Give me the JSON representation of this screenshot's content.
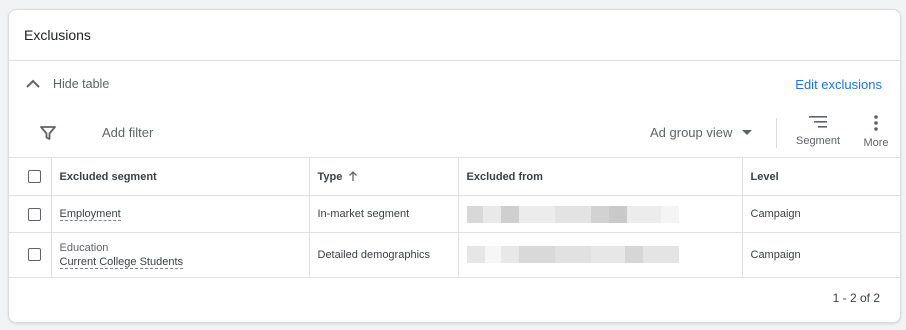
{
  "card": {
    "title": "Exclusions"
  },
  "controls": {
    "hide_table_label": "Hide table",
    "edit_exclusions_label": "Edit exclusions",
    "add_filter_label": "Add filter",
    "view_selector_value": "Ad group view",
    "segment_label": "Segment",
    "more_label": "More"
  },
  "table": {
    "headers": {
      "excluded_segment": "Excluded segment",
      "type": "Type",
      "excluded_from": "Excluded from",
      "level": "Level"
    },
    "sort": {
      "column": "type",
      "direction": "ascending"
    },
    "rows": [
      {
        "segment_category": "",
        "segment": "Employment",
        "type": "In-market segment",
        "excluded_from": "redacted",
        "level": "Campaign"
      },
      {
        "segment_category": "Education",
        "segment": "Current College Students",
        "type": "Detailed demographics",
        "excluded_from": "redacted",
        "level": "Campaign"
      }
    ]
  },
  "pagination": {
    "range_text": "1 - 2 of 2"
  },
  "colors": {
    "accent": "#1a73e8",
    "text": "#3c4043",
    "muted": "#5f6368",
    "border": "#e0e0e0"
  },
  "icons": {
    "collapse": "chevron-up-icon",
    "filter": "filter-icon",
    "dropdown": "caret-down-icon",
    "segment": "segment-icon",
    "more": "more-vert-icon",
    "sort": "arrow-up-icon"
  }
}
